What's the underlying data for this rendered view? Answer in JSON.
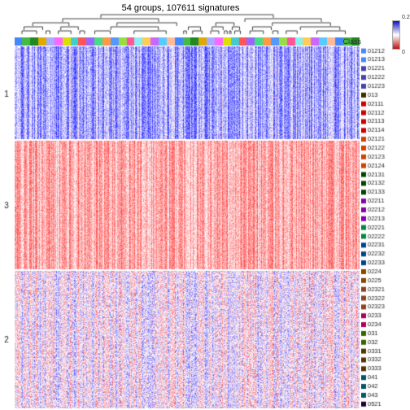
{
  "title": "54 groups, 107611 signatures",
  "legend": {
    "max_label": "0.2",
    "mid_label": "0",
    "class_label": "Class"
  },
  "row_labels": [
    "1",
    "",
    "3",
    "",
    "2"
  ],
  "col_labels": [
    "01212",
    "01213",
    "01221",
    "01222",
    "01223",
    "013",
    "02111",
    "02112",
    "02113",
    "02114",
    "02121",
    "02122",
    "02123",
    "02124",
    "02131",
    "02132",
    "02133",
    "02211",
    "02212",
    "02213",
    "02221",
    "02222",
    "02231",
    "02232",
    "02233",
    "0224",
    "0225",
    "02321",
    "02322",
    "02323",
    "0233",
    "0234",
    "031",
    "032",
    "0331",
    "0332",
    "0333",
    "041",
    "042",
    "043",
    "0521"
  ],
  "colorbar_colors": [
    "#4444ff",
    "#44ff44",
    "#228822",
    "#ffaa00",
    "#aaaaff",
    "#ff44ff",
    "#ffff44",
    "#44ffff",
    "#ff4444",
    "#8844ff",
    "#44ff88",
    "#ff8844",
    "#4488ff",
    "#88ff44",
    "#ff4488",
    "#88ffff",
    "#ffcc44",
    "#cc44ff",
    "#44ccff",
    "#ffaa88"
  ]
}
